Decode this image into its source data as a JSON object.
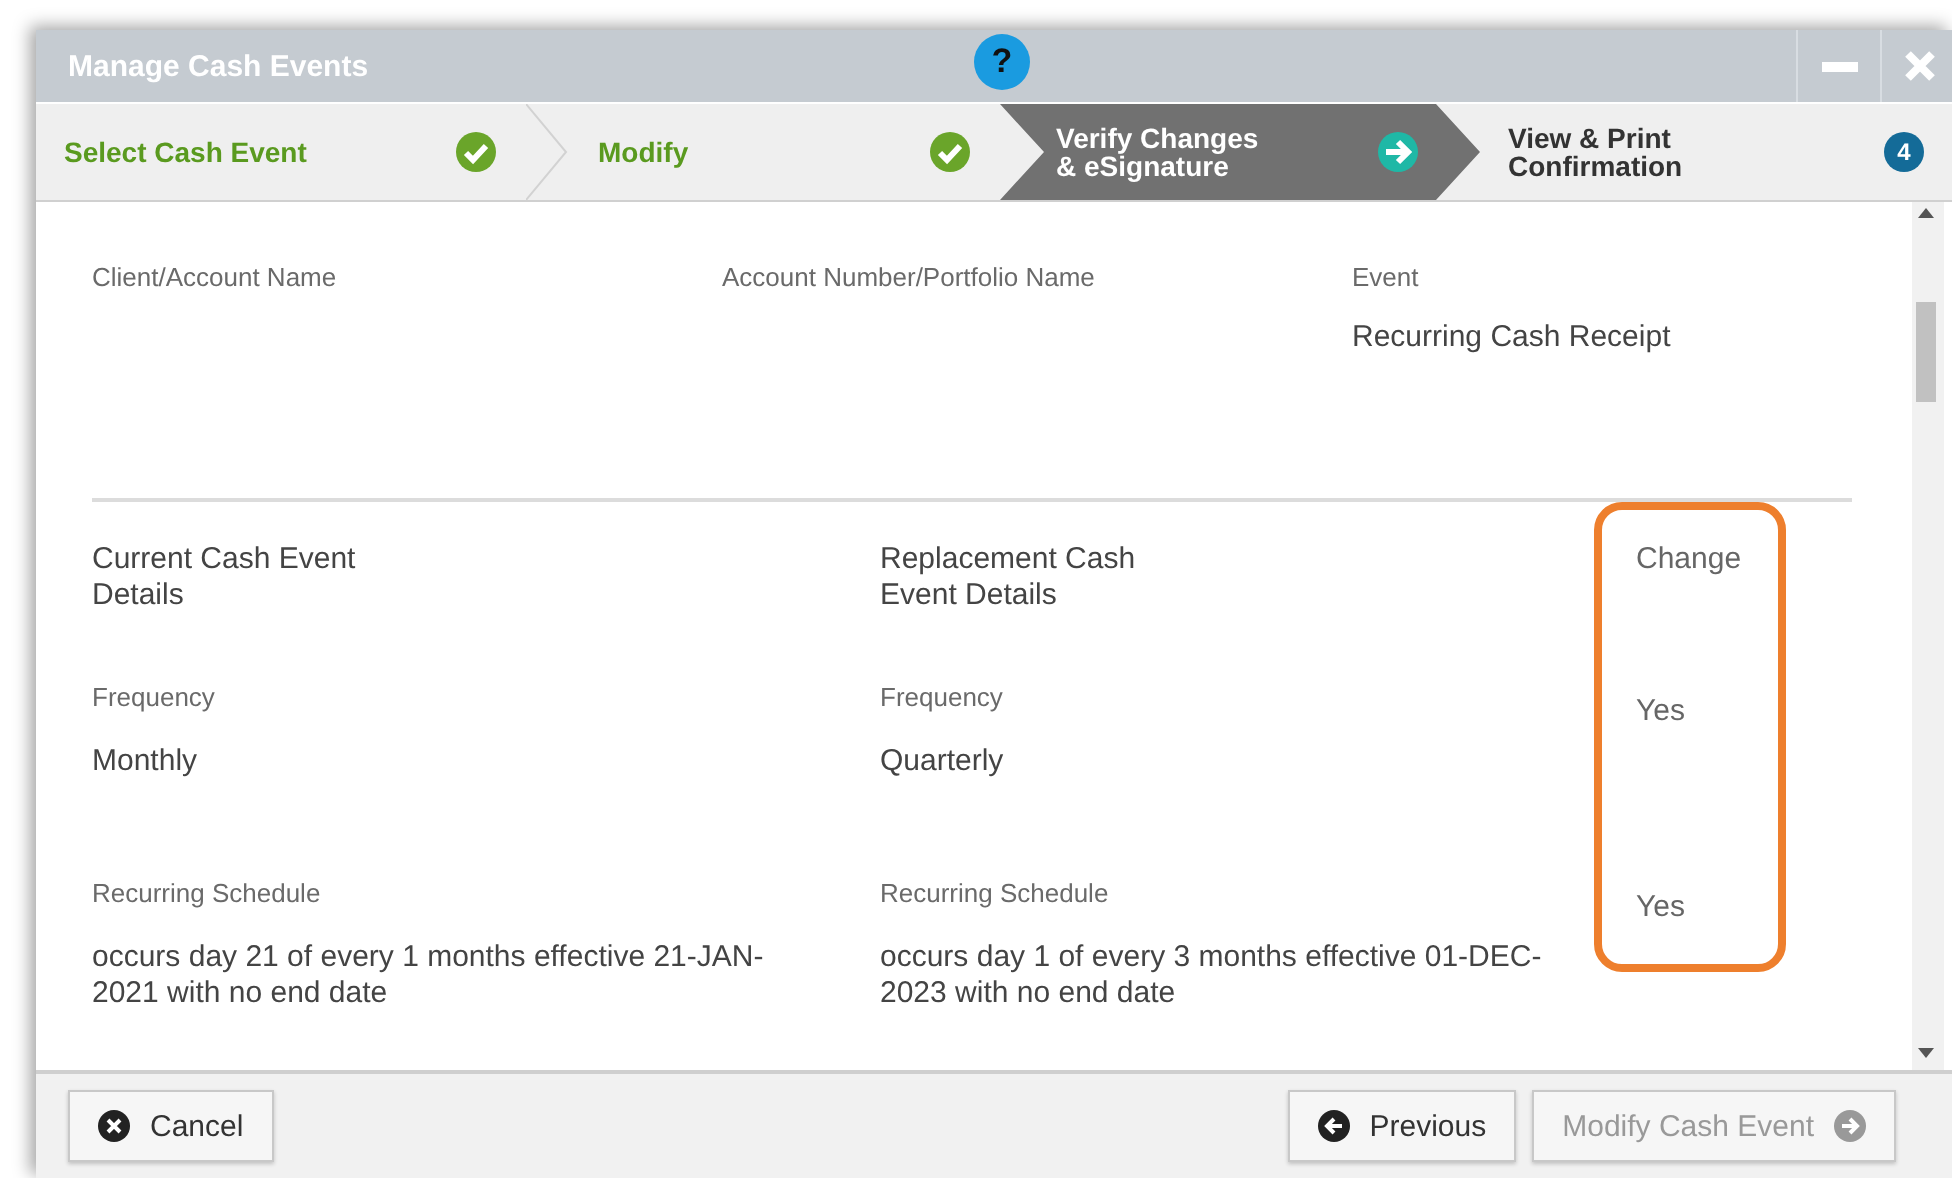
{
  "window": {
    "title": "Manage Cash Events",
    "help": "?"
  },
  "steps": [
    {
      "lines": [
        "Select Cash Event"
      ],
      "completed": true,
      "selected": false
    },
    {
      "lines": [
        "Modify"
      ],
      "completed": true,
      "selected": false
    },
    {
      "lines": [
        "Verify Changes",
        "& eSignature"
      ],
      "completed": false,
      "selected": true
    },
    {
      "lines": [
        "View & Print",
        "Confirmation"
      ],
      "completed": false,
      "selected": false,
      "number": "4"
    }
  ],
  "summary": [
    {
      "label": "Client/Account Name"
    },
    {
      "label": "Account Number/Portfolio Name"
    },
    {
      "label": "Event",
      "value": "Recurring Cash Receipt"
    }
  ],
  "comparison": {
    "headings": [
      "Current Cash Event Details",
      "Replacement Cash Event Details",
      "Change"
    ],
    "highlighted": true,
    "rows": [
      {
        "label_current": "Frequency",
        "current": "Monthly",
        "label_replacement": "Frequency",
        "replacement": "Quarterly",
        "change": "Yes"
      },
      {
        "label_current": "Recurring Schedule",
        "current": "occurs day 21 of every 1 months effective 21-JAN-2021 with no end date",
        "label_replacement": "Recurring Schedule",
        "replacement": "occurs day 1 of every 3 months effective 01-DEC-2023 with no end date",
        "change": "Yes"
      }
    ]
  },
  "footer": {
    "buttons": [
      {
        "label": "Cancel",
        "kind": "cancel",
        "disabled": false
      },
      {
        "label": "Previous",
        "kind": "previous",
        "disabled": false
      },
      {
        "label": "Modify Cash Event",
        "kind": "next",
        "disabled": true
      }
    ]
  }
}
